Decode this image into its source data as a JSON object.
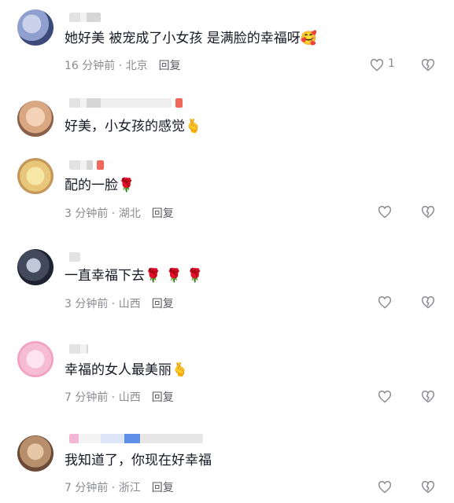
{
  "comments": [
    {
      "text": "她好美 被宠成了小女孩 是满脸的幸福呀🥰",
      "time": "16 分钟前",
      "location": "北京",
      "reply": "回复",
      "likes": "1"
    },
    {
      "text": "好美，小女孩的感觉🫰",
      "time": "",
      "location": "",
      "reply": "",
      "likes": ""
    },
    {
      "text": "配的一脸🌹",
      "time": "3 分钟前",
      "location": "湖北",
      "reply": "回复",
      "likes": ""
    },
    {
      "text": "一直幸福下去🌹 🌹 🌹",
      "time": "3 分钟前",
      "location": "山西",
      "reply": "回复",
      "likes": ""
    },
    {
      "text": "幸福的女人最美丽🫰",
      "time": "7 分钟前",
      "location": "山西",
      "reply": "回复",
      "likes": ""
    },
    {
      "text": "我知道了，你现在好幸福",
      "time": "7 分钟前",
      "location": "浙江",
      "reply": "回复",
      "likes": ""
    }
  ],
  "separator": " · ",
  "icons": {
    "like": "heart-outline-icon",
    "dislike": "broken-heart-icon"
  },
  "colors": {
    "text": "#161823",
    "meta": "#8a8b91",
    "icon": "#8a8b91"
  }
}
